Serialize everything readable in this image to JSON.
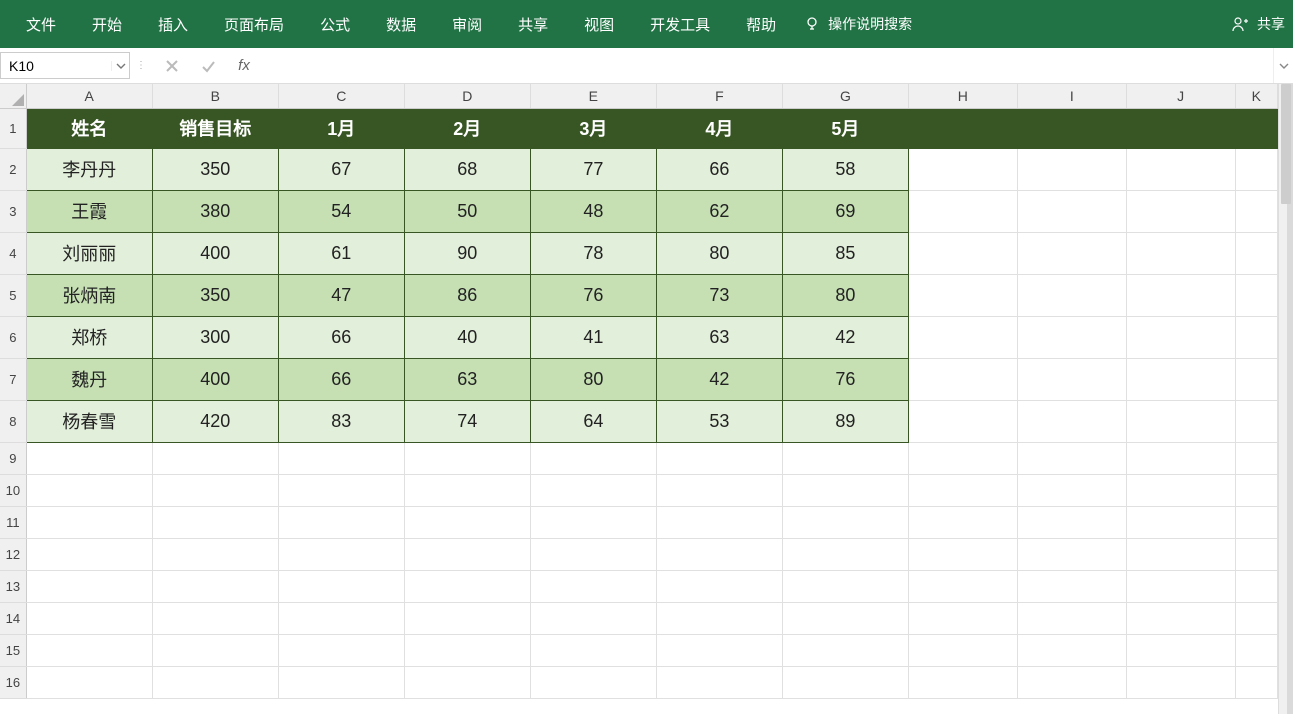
{
  "ribbon": {
    "tabs": [
      "文件",
      "开始",
      "插入",
      "页面布局",
      "公式",
      "数据",
      "审阅",
      "共享",
      "视图",
      "开发工具",
      "帮助"
    ],
    "search_label": "操作说明搜索",
    "share_label": "共享"
  },
  "name_box": "K10",
  "formula": "",
  "columns": [
    "A",
    "B",
    "C",
    "D",
    "E",
    "F",
    "G",
    "H",
    "I",
    "J",
    "K"
  ],
  "row_numbers": [
    1,
    2,
    3,
    4,
    5,
    6,
    7,
    8,
    9,
    10,
    11,
    12,
    13,
    14,
    15,
    16
  ],
  "data_headers": [
    "姓名",
    "销售目标",
    "1月",
    "2月",
    "3月",
    "4月",
    "5月"
  ],
  "data_rows": [
    [
      "李丹丹",
      "350",
      "67",
      "68",
      "77",
      "66",
      "58"
    ],
    [
      "王霞",
      "380",
      "54",
      "50",
      "48",
      "62",
      "69"
    ],
    [
      "刘丽丽",
      "400",
      "61",
      "90",
      "78",
      "80",
      "85"
    ],
    [
      "张炳南",
      "350",
      "47",
      "86",
      "76",
      "73",
      "80"
    ],
    [
      "郑桥",
      "300",
      "66",
      "40",
      "41",
      "63",
      "42"
    ],
    [
      "魏丹",
      "400",
      "66",
      "63",
      "80",
      "42",
      "76"
    ],
    [
      "杨春雪",
      "420",
      "83",
      "74",
      "64",
      "53",
      "89"
    ]
  ],
  "chart_data": {
    "type": "table",
    "title": "",
    "columns": [
      "姓名",
      "销售目标",
      "1月",
      "2月",
      "3月",
      "4月",
      "5月"
    ],
    "rows": [
      {
        "姓名": "李丹丹",
        "销售目标": 350,
        "1月": 67,
        "2月": 68,
        "3月": 77,
        "4月": 66,
        "5月": 58
      },
      {
        "姓名": "王霞",
        "销售目标": 380,
        "1月": 54,
        "2月": 50,
        "3月": 48,
        "4月": 62,
        "5月": 69
      },
      {
        "姓名": "刘丽丽",
        "销售目标": 400,
        "1月": 61,
        "2月": 90,
        "3月": 78,
        "4月": 80,
        "5月": 85
      },
      {
        "姓名": "张炳南",
        "销售目标": 350,
        "1月": 47,
        "2月": 86,
        "3月": 76,
        "4月": 73,
        "5月": 80
      },
      {
        "姓名": "郑桥",
        "销售目标": 300,
        "1月": 66,
        "2月": 40,
        "3月": 41,
        "4月": 63,
        "5月": 42
      },
      {
        "姓名": "魏丹",
        "销售目标": 400,
        "1月": 66,
        "2月": 63,
        "3月": 80,
        "4月": 42,
        "5月": 76
      },
      {
        "姓名": "杨春雪",
        "销售目标": 420,
        "1月": 83,
        "2月": 74,
        "3月": 64,
        "4月": 53,
        "5月": 89
      }
    ]
  }
}
